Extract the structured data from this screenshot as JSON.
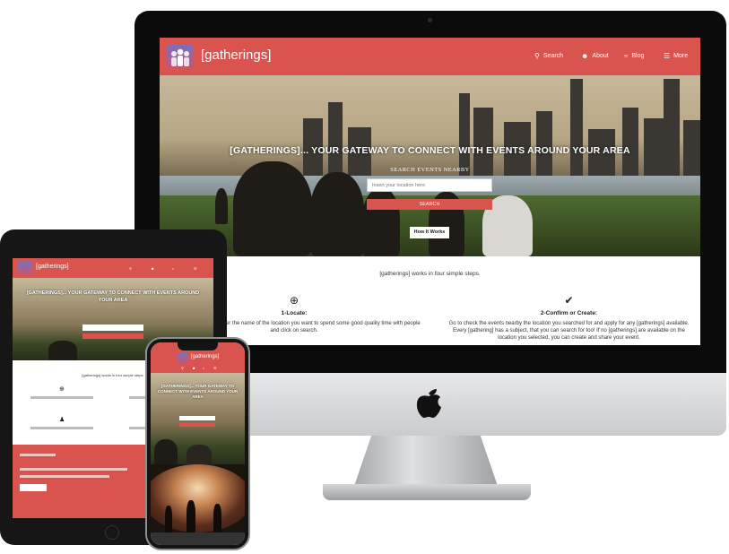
{
  "brand": {
    "name": "[gatherings]",
    "accent": "#d9534f"
  },
  "nav": {
    "items": [
      {
        "label": "Search",
        "icon": "search-icon"
      },
      {
        "label": "About",
        "icon": "user-icon"
      },
      {
        "label": "Blog",
        "icon": "rss-icon"
      },
      {
        "label": "More",
        "icon": "menu-icon"
      }
    ]
  },
  "hero": {
    "title": "[GATHERINGS]... YOUR GATEWAY TO CONNECT WITH EVENTS AROUND YOUR AREA",
    "search_label": "SEARCH EVENTS NEARBY",
    "search_placeholder": "Insert your location here",
    "search_button": "SEARCH",
    "how_button": "How It Works"
  },
  "steps": {
    "intro": "[gatherings] works in four simple steps.",
    "items": [
      {
        "title": "1-Locate:",
        "icon": "zoom-in-icon",
        "text": "therings] homepage, enter the name of the location you want to spend some good quality time with people and click on search."
      },
      {
        "title": "2-Confirm or Create:",
        "icon": "double-check-icon",
        "text": "Go to check the events nearby the location you searched for and apply for any [gatherings] available. Every [gathering] has a subject, that you can search for too! If no [gatherings] are available on the location you selected, you can create and share your event."
      }
    ]
  }
}
